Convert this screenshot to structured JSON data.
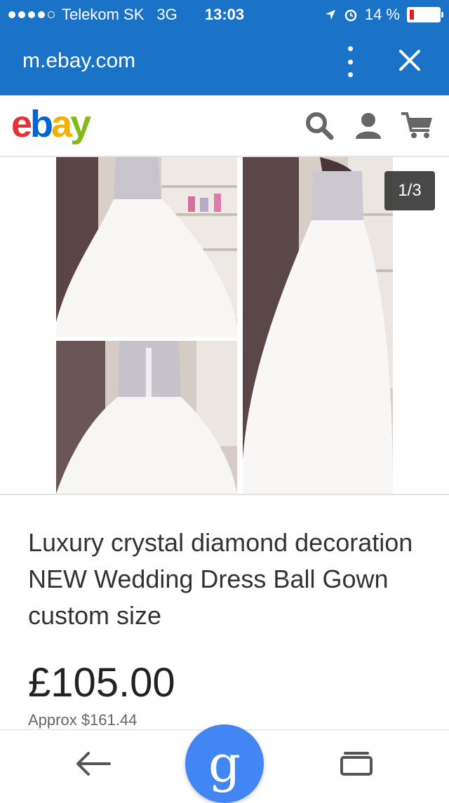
{
  "status_bar": {
    "carrier": "Telekom SK",
    "network": "3G",
    "time": "13:03",
    "battery_text": "14 %",
    "battery_level": 0.14,
    "battery_color": "#e02020"
  },
  "browser": {
    "url": "m.ebay.com",
    "menu_icon": "more-vert-icon",
    "close_icon": "close-icon",
    "accent": "#1a73c7"
  },
  "ebay_header": {
    "logo": "ebay",
    "icons": [
      "search-icon",
      "account-icon",
      "cart-icon"
    ]
  },
  "gallery": {
    "counter": "1/3"
  },
  "item": {
    "title": "Luxury crystal diamond decoration NEW Wedding Dress Ball Gown custom size",
    "price": "£105.00",
    "approx": "Approx $161.44"
  },
  "bottom_nav": {
    "back_icon": "back-arrow-icon",
    "google_label": "g",
    "google_color": "#4285f4",
    "tabs_icon": "tabs-icon"
  }
}
